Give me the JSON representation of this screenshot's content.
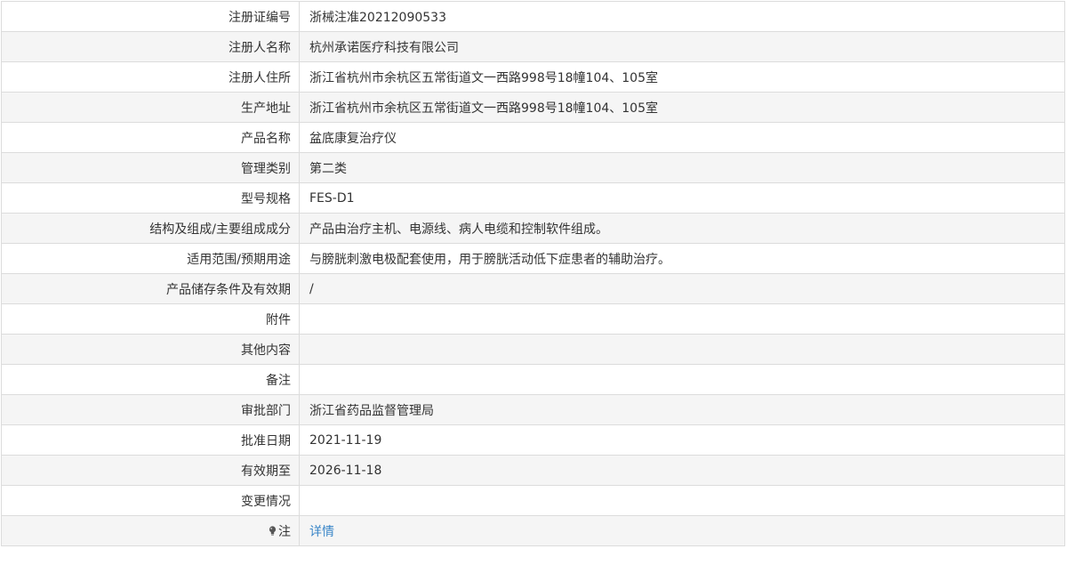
{
  "rows": [
    {
      "label": "注册证编号",
      "value": "浙械注准20212090533"
    },
    {
      "label": "注册人名称",
      "value": "杭州承诺医疗科技有限公司"
    },
    {
      "label": "注册人住所",
      "value": "浙江省杭州市余杭区五常街道文一西路998号18幢104、105室"
    },
    {
      "label": "生产地址",
      "value": "浙江省杭州市余杭区五常街道文一西路998号18幢104、105室"
    },
    {
      "label": "产品名称",
      "value": "盆底康复治疗仪"
    },
    {
      "label": "管理类别",
      "value": "第二类"
    },
    {
      "label": "型号规格",
      "value": "FES-D1"
    },
    {
      "label": "结构及组成/主要组成成分",
      "value": "产品由治疗主机、电源线、病人电缆和控制软件组成。"
    },
    {
      "label": "适用范围/预期用途",
      "value": "与膀胱刺激电极配套使用，用于膀胱活动低下症患者的辅助治疗。"
    },
    {
      "label": "产品储存条件及有效期",
      "value": "/"
    },
    {
      "label": "附件",
      "value": ""
    },
    {
      "label": "其他内容",
      "value": ""
    },
    {
      "label": "备注",
      "value": ""
    },
    {
      "label": "审批部门",
      "value": "浙江省药品监督管理局"
    },
    {
      "label": "批准日期",
      "value": "2021-11-19"
    },
    {
      "label": "有效期至",
      "value": "2026-11-18"
    },
    {
      "label": "变更情况",
      "value": ""
    }
  ],
  "note": {
    "label": "注",
    "icon": "lightbulb-icon",
    "link_text": "详情",
    "link_color": "#3a86c8"
  }
}
